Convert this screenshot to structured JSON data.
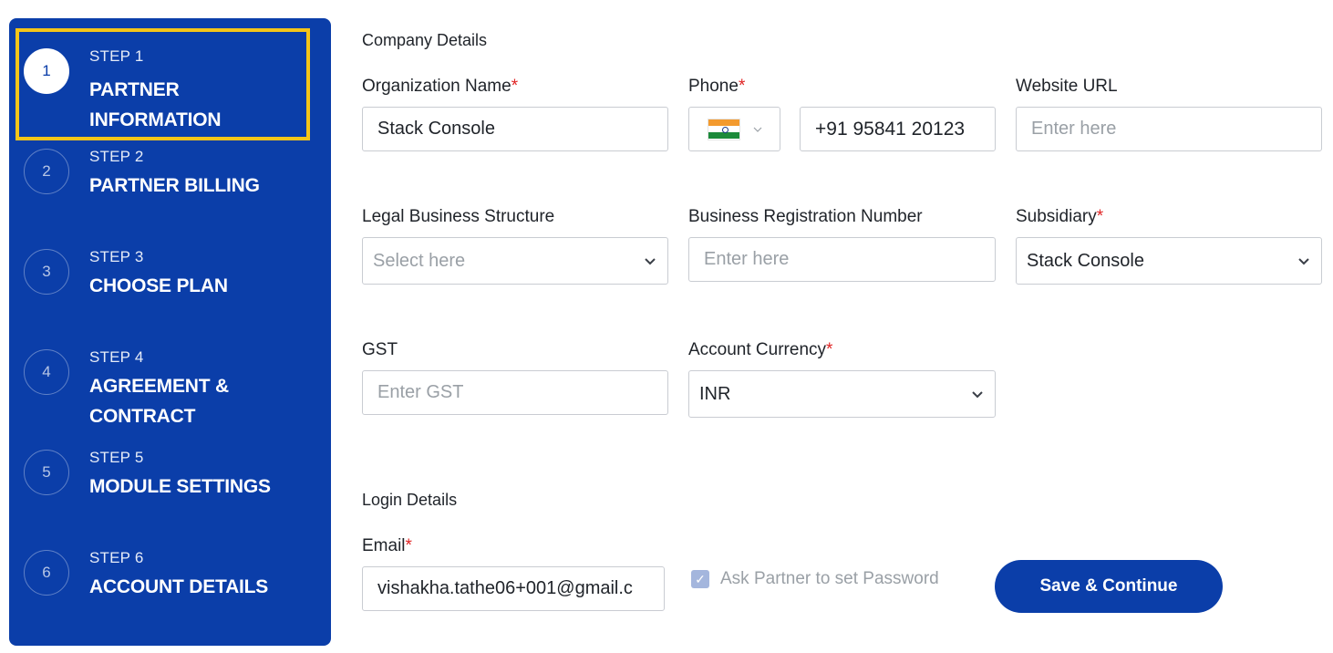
{
  "sidebar": {
    "steps": [
      {
        "number": "1",
        "step_label": "STEP 1",
        "title": "PARTNER INFORMATION"
      },
      {
        "number": "2",
        "step_label": "STEP 2",
        "title": "PARTNER BILLING"
      },
      {
        "number": "3",
        "step_label": "STEP 3",
        "title": "CHOOSE PLAN"
      },
      {
        "number": "4",
        "step_label": "STEP 4",
        "title": "AGREEMENT & CONTRACT"
      },
      {
        "number": "5",
        "step_label": "STEP 5",
        "title": "MODULE SETTINGS"
      },
      {
        "number": "6",
        "step_label": "STEP 6",
        "title": "ACCOUNT DETAILS"
      }
    ],
    "active_step": 1,
    "colors": {
      "background": "#0b3ea9",
      "highlight": "#f5c518"
    }
  },
  "company": {
    "section_title": "Company Details",
    "org_name": {
      "label": "Organization Name",
      "required": "*",
      "value": "Stack Console"
    },
    "phone": {
      "label": "Phone",
      "required": "*",
      "country_flag": "india-flag-icon",
      "value": "+91 95841 20123"
    },
    "website": {
      "label": "Website URL",
      "placeholder": "Enter here"
    },
    "legal_structure": {
      "label": "Legal Business Structure",
      "placeholder": "Select here"
    },
    "registration_number": {
      "label": "Business Registration Number",
      "placeholder": "Enter here"
    },
    "subsidiary": {
      "label": "Subsidiary",
      "required": "*",
      "value": "Stack Console"
    },
    "gst": {
      "label": "GST",
      "placeholder": "Enter GST"
    },
    "currency": {
      "label": "Account Currency",
      "required": "*",
      "value": "INR"
    }
  },
  "login": {
    "section_title": "Login Details",
    "email": {
      "label": "Email",
      "required": "*",
      "value": "vishakha.tathe06+001@gmail.c"
    },
    "ask_password": {
      "label": "Ask Partner to set Password",
      "checked": true
    }
  },
  "actions": {
    "save_label": "Save & Continue"
  },
  "colors": {
    "primary": "#0b3ea9",
    "required": "#e02424"
  }
}
